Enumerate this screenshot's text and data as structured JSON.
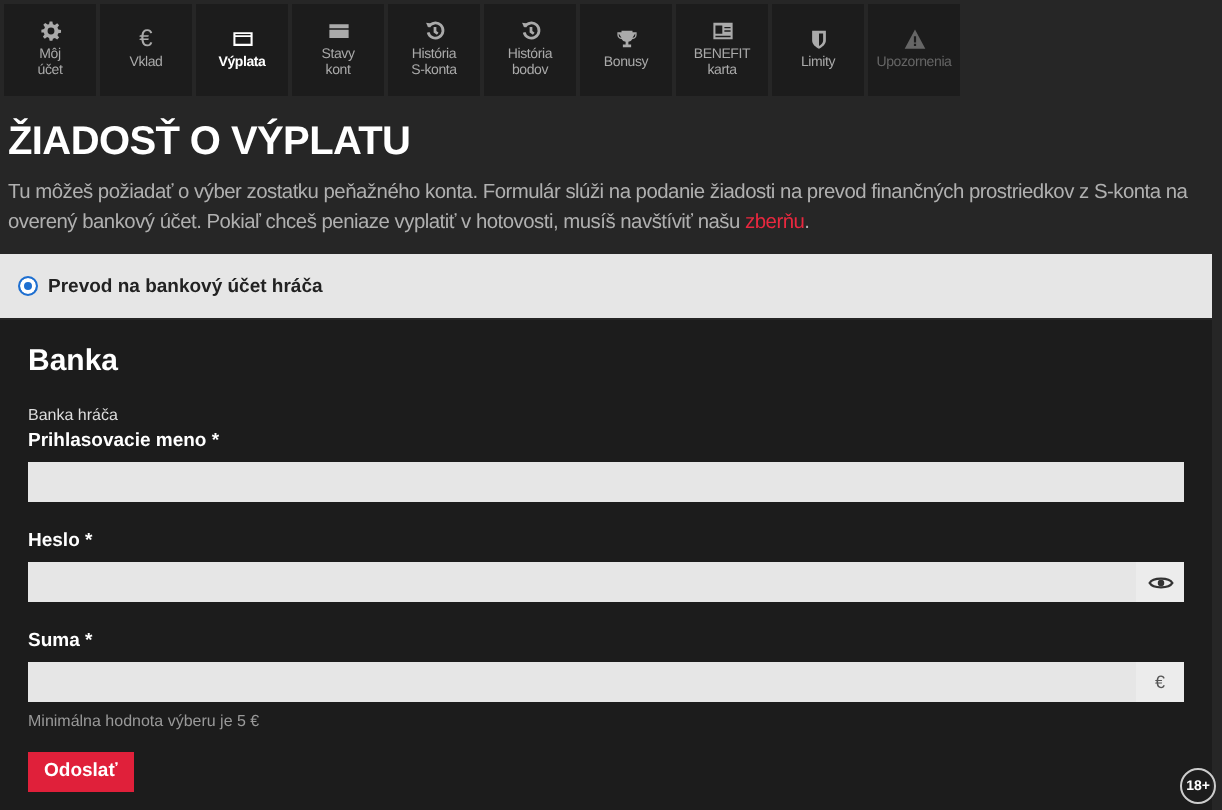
{
  "tabs": [
    {
      "label": "Môj\núčet",
      "kind": "gear",
      "selected": false,
      "disabled": false
    },
    {
      "label": "Vklad",
      "kind": "glyph",
      "glyph": "€",
      "selected": false,
      "disabled": false
    },
    {
      "label": "Výplata",
      "kind": "card",
      "selected": true,
      "disabled": false
    },
    {
      "label": "Stavy\nkont",
      "kind": "cards",
      "selected": false,
      "disabled": false
    },
    {
      "label": "História\nS-konta",
      "kind": "history",
      "selected": false,
      "disabled": false
    },
    {
      "label": "História\nbodov",
      "kind": "history",
      "selected": false,
      "disabled": false
    },
    {
      "label": "Bonusy",
      "kind": "trophy",
      "selected": false,
      "disabled": false
    },
    {
      "label": "BENEFIT\nkarta",
      "kind": "idcard",
      "selected": false,
      "disabled": false
    },
    {
      "label": "Limity",
      "kind": "shield",
      "selected": false,
      "disabled": false
    },
    {
      "label": "Upozornenia",
      "kind": "warning",
      "selected": false,
      "disabled": true
    }
  ],
  "title": "ŽIADOSŤ O VÝPLATU",
  "intro": {
    "text": "Tu môžeš požiadať o výber zostatku peňažného konta. Formulár slúži na podanie žiadosti na prevod finančných prostriedkov z S-konta na overený bankový účet. Pokiaľ chceš peniaze vyplatiť v hotovosti, musíš navštíviť našu ",
    "link": "zberňu",
    "after": "."
  },
  "method": {
    "label": "Prevod na bankový účet hráča",
    "selected": true
  },
  "form": {
    "heading": "Banka",
    "subheading": "Banka hráča",
    "fields": [
      {
        "kind": "text",
        "label": "Prihlasovacie meno *"
      },
      {
        "kind": "password",
        "label": "Heslo *"
      },
      {
        "kind": "amount",
        "label": "Suma *",
        "suffix": "€",
        "hint": "Minimálna hodnota výberu je 5 €"
      }
    ],
    "submit": "Odoslať"
  },
  "age_badge": "18+"
}
